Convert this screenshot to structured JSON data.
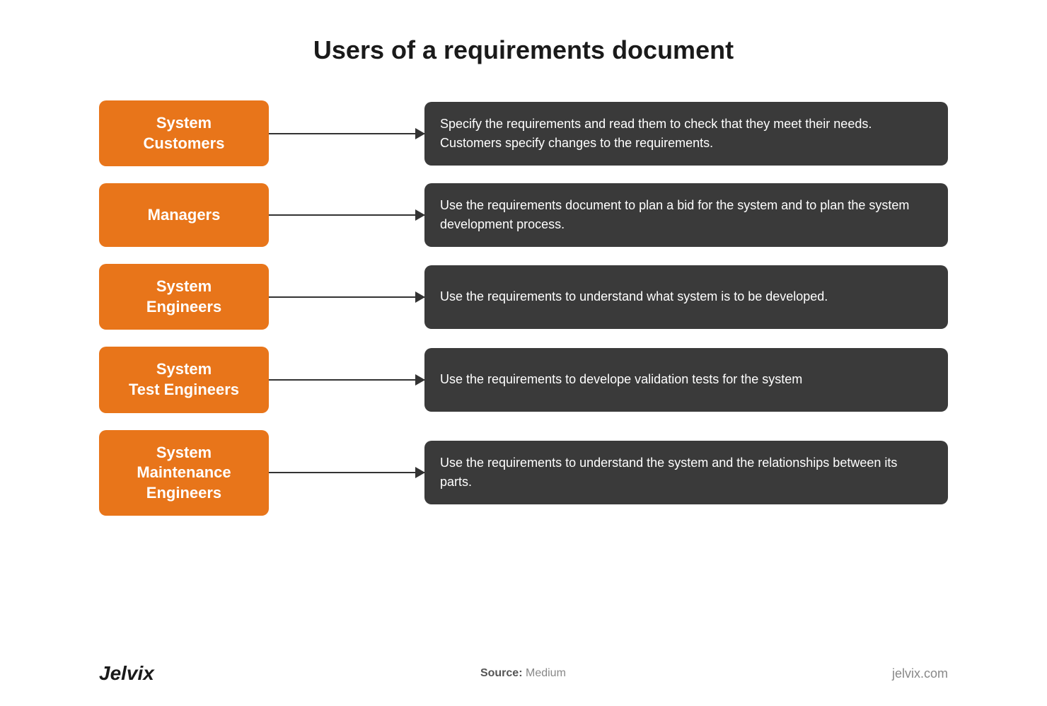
{
  "title": "Users of a requirements document",
  "rows": [
    {
      "id": "system-customers",
      "box_label": "System\nCustomers",
      "description": "Specify the requirements and read them to check that they meet their needs. Customers specify changes to the requirements."
    },
    {
      "id": "managers",
      "box_label": "Managers",
      "description": "Use the requirements document to plan a bid for the system and to plan the system development process."
    },
    {
      "id": "system-engineers",
      "box_label": "System\nEngineers",
      "description": "Use the requirements to understand what system is to be developed."
    },
    {
      "id": "system-test-engineers",
      "box_label": "System\nTest Engineers",
      "description": "Use the requirements to develope validation tests for the system"
    },
    {
      "id": "system-maintenance-engineers",
      "box_label": "System\nMaintenance\nEngineers",
      "description": "Use the requirements to understand the system and the relationships between its parts."
    }
  ],
  "footer": {
    "brand_left": "Jelvix",
    "source_label": "Source:",
    "source_value": "Medium",
    "brand_right": "jelvix.com"
  },
  "colors": {
    "orange": "#e8751a",
    "dark": "#3a3a3a",
    "arrow": "#333333"
  }
}
